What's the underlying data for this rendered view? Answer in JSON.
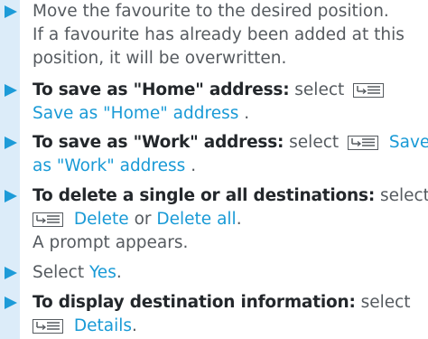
{
  "steps": [
    {
      "lines": [
        "Move the favourite to the desired position.",
        "If a favourite has already been added at this",
        "position, it will be overwritten."
      ]
    },
    {
      "bold": "To save as \"Home\" address:",
      "select": "select",
      "option": "Save as \"Home\" address",
      "period": "."
    },
    {
      "bold": "To save as \"Work\" address:",
      "select": "select",
      "option_a": "Save",
      "option_b": "as \"Work\" address",
      "period": "."
    },
    {
      "bold": "To delete a single or all destinations:",
      "select": "select",
      "option1": "Delete",
      "or": "or",
      "option2": "Delete all",
      "period": ".",
      "result": "A prompt appears."
    },
    {
      "select": "Select",
      "option": "Yes",
      "period": "."
    },
    {
      "bold": "To display destination information:",
      "select": "select",
      "option": "Details",
      "period": "."
    }
  ],
  "colors": {
    "sidebar": "#dcecf9",
    "arrow": "#1d9bd8",
    "highlight": "#199ad6",
    "bold_text": "#23272b",
    "body_text": "#555a5f"
  },
  "icons": {
    "menu": "menu-icon"
  }
}
